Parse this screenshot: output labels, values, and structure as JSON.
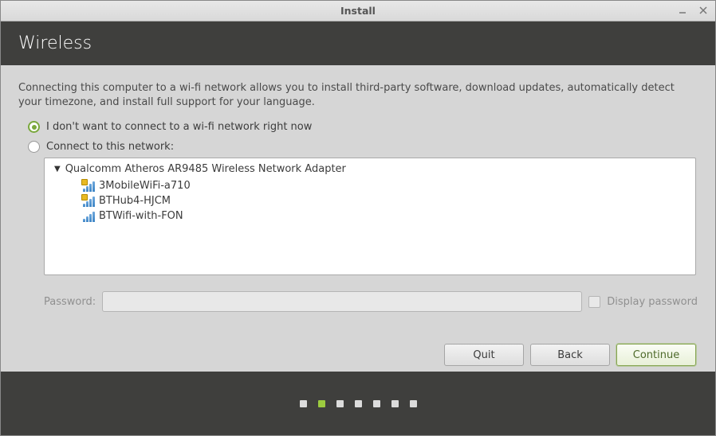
{
  "window": {
    "title": "Install"
  },
  "header": {
    "title": "Wireless"
  },
  "intro": "Connecting this computer to a wi-fi network allows you to install third-party software, download updates, automatically detect your timezone, and install full support for your language.",
  "options": {
    "no_connect": "I don't want to connect to a wi-fi network right now",
    "connect_to": "Connect to this network:"
  },
  "adapter": "Qualcomm Atheros AR9485 Wireless Network Adapter",
  "networks": [
    {
      "name": "3MobileWiFi-a710",
      "secured": true
    },
    {
      "name": "BTHub4-HJCM",
      "secured": true
    },
    {
      "name": "BTWifi-with-FON",
      "secured": false
    }
  ],
  "password": {
    "label": "Password:",
    "display_label": "Display password"
  },
  "buttons": {
    "quit": "Quit",
    "back": "Back",
    "continue": "Continue"
  },
  "progress": {
    "total": 7,
    "current": 2
  }
}
